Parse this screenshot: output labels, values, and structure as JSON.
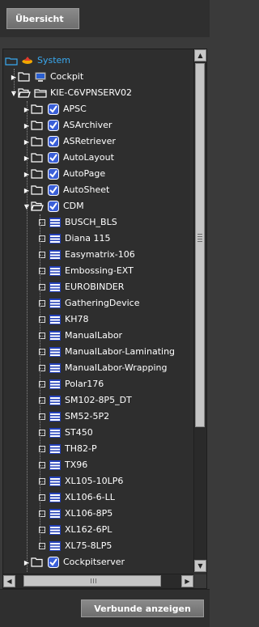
{
  "header": {
    "overview_button": "Übersicht"
  },
  "tree": [
    {
      "label": "System",
      "icon": "system-icon",
      "expanded": true,
      "selected": true,
      "level": 0
    },
    {
      "label": "Cockpit",
      "icon": "computer-icon",
      "expanded": false,
      "level": 1
    },
    {
      "label": "KIE-C6VPNSERV02",
      "icon": "server-folder-icon",
      "expanded": true,
      "level": 1
    },
    {
      "label": "APSC",
      "icon": "check-icon",
      "expanded": false,
      "level": 2
    },
    {
      "label": "ASArchiver",
      "icon": "check-icon",
      "expanded": false,
      "level": 2
    },
    {
      "label": "ASRetriever",
      "icon": "check-icon",
      "expanded": false,
      "level": 2
    },
    {
      "label": "AutoLayout",
      "icon": "check-icon",
      "expanded": false,
      "level": 2
    },
    {
      "label": "AutoPage",
      "icon": "check-icon",
      "expanded": false,
      "level": 2
    },
    {
      "label": "AutoSheet",
      "icon": "check-icon",
      "expanded": false,
      "level": 2
    },
    {
      "label": "CDM",
      "icon": "check-icon",
      "expanded": true,
      "level": 2
    },
    {
      "label": "BUSCH_BLS",
      "icon": "device-icon",
      "level": 3
    },
    {
      "label": "Diana 115",
      "icon": "device-icon",
      "level": 3
    },
    {
      "label": "Easymatrix-106",
      "icon": "device-icon",
      "level": 3
    },
    {
      "label": "Embossing-EXT",
      "icon": "device-icon",
      "level": 3
    },
    {
      "label": "EUROBINDER",
      "icon": "device-icon",
      "level": 3
    },
    {
      "label": "GatheringDevice",
      "icon": "device-icon",
      "level": 3
    },
    {
      "label": "KH78",
      "icon": "device-icon",
      "level": 3
    },
    {
      "label": "ManualLabor",
      "icon": "device-icon",
      "level": 3
    },
    {
      "label": "ManualLabor-Laminating",
      "icon": "device-icon",
      "level": 3
    },
    {
      "label": "ManualLabor-Wrapping",
      "icon": "device-icon",
      "level": 3
    },
    {
      "label": "Polar176",
      "icon": "device-icon",
      "level": 3
    },
    {
      "label": "SM102-8P5_DT",
      "icon": "device-icon",
      "level": 3
    },
    {
      "label": "SM52-5P2",
      "icon": "device-icon",
      "level": 3
    },
    {
      "label": "ST450",
      "icon": "device-icon",
      "level": 3
    },
    {
      "label": "TH82-P",
      "icon": "device-icon",
      "level": 3
    },
    {
      "label": "TX96",
      "icon": "device-icon",
      "level": 3
    },
    {
      "label": "XL105-10LP6",
      "icon": "device-icon",
      "level": 3
    },
    {
      "label": "XL106-6-LL",
      "icon": "device-icon",
      "level": 3
    },
    {
      "label": "XL106-8P5",
      "icon": "device-icon",
      "level": 3
    },
    {
      "label": "XL162-6PL",
      "icon": "device-icon",
      "level": 3
    },
    {
      "label": "XL75-8LP5",
      "icon": "device-icon",
      "level": 3
    },
    {
      "label": "Cockpitserver",
      "icon": "check-icon",
      "expanded": false,
      "level": 2
    }
  ],
  "footer": {
    "show_connections_button": "Verbunde anzeigen"
  },
  "colors": {
    "selected_text": "#39a9f0",
    "panel_bg": "#2e2e2e"
  }
}
